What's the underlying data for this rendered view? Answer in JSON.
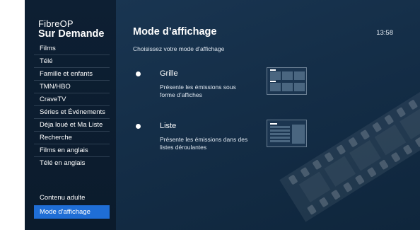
{
  "brand": {
    "line1": "FibreOP",
    "line2": "Sur Demande"
  },
  "sidebar": {
    "items": [
      {
        "label": "Films"
      },
      {
        "label": "Télé"
      },
      {
        "label": "Famille et enfants"
      },
      {
        "label": "TMN/HBO"
      },
      {
        "label": "CraveTV"
      },
      {
        "label": "Séries et Événements"
      },
      {
        "label": "Déja loué et Ma Liste"
      },
      {
        "label": "Recherche"
      },
      {
        "label": "Films en anglais"
      },
      {
        "label": "Télé en anglais"
      }
    ],
    "bottom_items": [
      {
        "label": "Contenu adulte"
      },
      {
        "label": "Mode d'affichage",
        "selected": true
      }
    ]
  },
  "main": {
    "title": "Mode d’affichage",
    "clock": "13:58",
    "subtitle": "Choisissez votre mode d’affichage",
    "options": [
      {
        "title": "Grille",
        "description": "Présente les émissions sous forme d’affiches",
        "icon": "grid-layout-icon"
      },
      {
        "title": "Liste",
        "description": "Présente les émissions dans des listes déroulantes",
        "icon": "list-layout-icon"
      }
    ]
  },
  "colors": {
    "accent": "#1f6ed6",
    "background": "#11283d"
  }
}
